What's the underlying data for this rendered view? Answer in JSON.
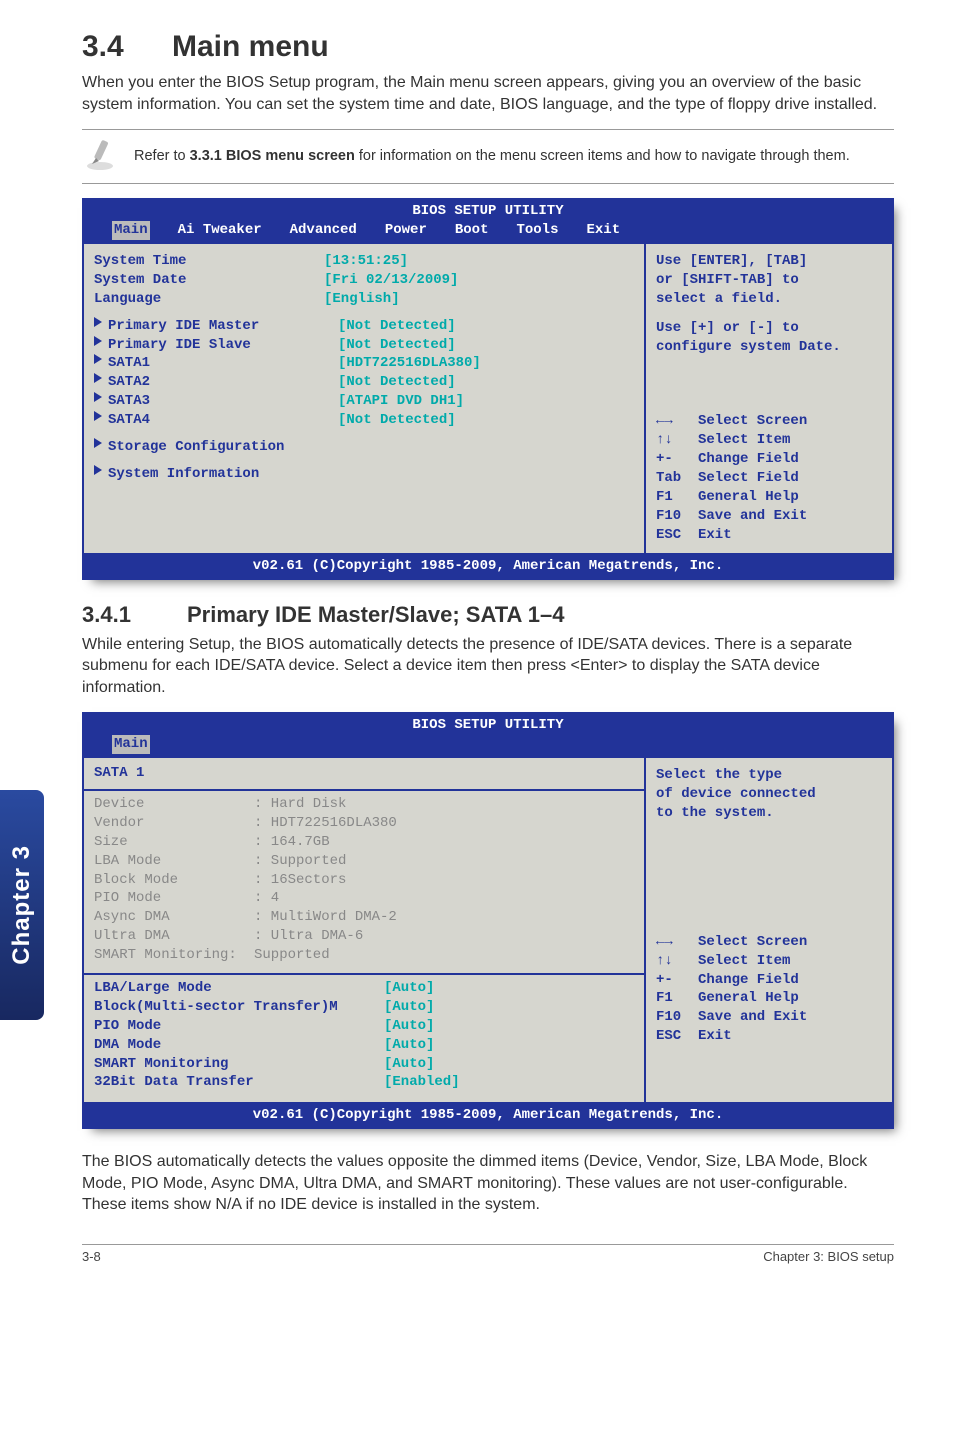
{
  "heading": {
    "num": "3.4",
    "title": "Main menu"
  },
  "intro": "When you enter the BIOS Setup program, the Main menu screen appears, giving you an overview of the basic system information. You can set the system time and date, BIOS language, and the type of floppy drive installed.",
  "note": {
    "pre": "Refer to ",
    "bold": "3.3.1 BIOS menu screen",
    "post": " for information on the menu screen items and how to navigate through them."
  },
  "bios1": {
    "title": "BIOS SETUP UTILITY",
    "tabs": [
      "Main",
      "Ai Tweaker",
      "Advanced",
      "Power",
      "Boot",
      "Tools",
      "Exit"
    ],
    "time_lbl": "System Time",
    "time_val": "[13:51:25]",
    "date_lbl": "System Date",
    "date_val": "[Fri 02/13/2009]",
    "lang_lbl": "Language",
    "lang_val": "[English]",
    "pim": "Primary IDE Master",
    "pim_v": "[Not Detected]",
    "pis": "Primary IDE Slave",
    "pis_v": "[Not Detected]",
    "s1": "SATA1",
    "s1_v": "[HDT722516DLA380]",
    "s2": "SATA2",
    "s2_v": "[Not Detected]",
    "s3": "SATA3",
    "s3_v": "[ATAPI DVD DH1]",
    "s4": "SATA4",
    "s4_v": "[Not Detected]",
    "storage": "Storage Configuration",
    "sysinfo": "System Information",
    "help1": "Use [ENTER], [TAB]",
    "help2": "or [SHIFT-TAB] to",
    "help3": "select a field.",
    "help4": "Use [+] or [-] to",
    "help5": "configure system Date.",
    "nav": {
      "ss": "Select Screen",
      "si": "Select Item",
      "cf": "Change Field",
      "sf": "Select Field",
      "gh": "General Help",
      "se": "Save and Exit",
      "ex": "Exit",
      "k1": "←→",
      "k2": "↑↓",
      "k3": "+-",
      "k4": "Tab",
      "k5": "F1",
      "k6": "F10",
      "k7": "ESC"
    },
    "status": "v02.61 (C)Copyright 1985-2009, American Megatrends, Inc."
  },
  "sub": {
    "num": "3.4.1",
    "title": "Primary IDE Master/Slave; SATA 1–4"
  },
  "sub_intro": "While entering Setup, the BIOS automatically detects the presence of IDE/SATA devices. There is a separate submenu for each IDE/SATA device. Select a device item then press <Enter> to display the SATA device information.",
  "bios2": {
    "title": "BIOS SETUP UTILITY",
    "tab": "Main",
    "panel_title": "SATA 1",
    "info": {
      "device_l": "Device",
      "device_v": ": Hard Disk",
      "vendor_l": "Vendor",
      "vendor_v": ": HDT722516DLA380",
      "size_l": "Size",
      "size_v": ": 164.7GB",
      "lba_l": "LBA Mode",
      "lba_v": ": Supported",
      "block_l": "Block Mode",
      "block_v": ": 16Sectors",
      "pio_l": "PIO Mode",
      "pio_v": ": 4",
      "adma_l": "Async DMA",
      "adma_v": ": MultiWord DMA-2",
      "udma_l": "Ultra DMA",
      "udma_v": ": Ultra DMA-6",
      "smart_l": "SMART Monitoring:",
      "smart_v": "Supported"
    },
    "opts": {
      "o1_l": "LBA/Large Mode",
      "o1_v": "[Auto]",
      "o2_l": "Block(Multi-sector Transfer)M",
      "o2_v": "[Auto]",
      "o3_l": "PIO Mode",
      "o3_v": "[Auto]",
      "o4_l": "DMA Mode",
      "o4_v": "[Auto]",
      "o5_l": "SMART Monitoring",
      "o5_v": "[Auto]",
      "o6_l": "32Bit Data Transfer",
      "o6_v": "[Enabled]"
    },
    "help1": "Select the type",
    "help2": "of device connected",
    "help3": "to the system.",
    "status": "v02.61 (C)Copyright 1985-2009, American Megatrends, Inc."
  },
  "post": "The BIOS automatically detects the values opposite the dimmed items (Device, Vendor, Size, LBA Mode, Block Mode, PIO Mode, Async DMA, Ultra DMA, and SMART monitoring). These values are not user-configurable. These items show N/A if no IDE device is installed in the system.",
  "chapter_tab": "Chapter 3",
  "footer": {
    "left": "3-8",
    "right": "Chapter 3: BIOS setup"
  }
}
